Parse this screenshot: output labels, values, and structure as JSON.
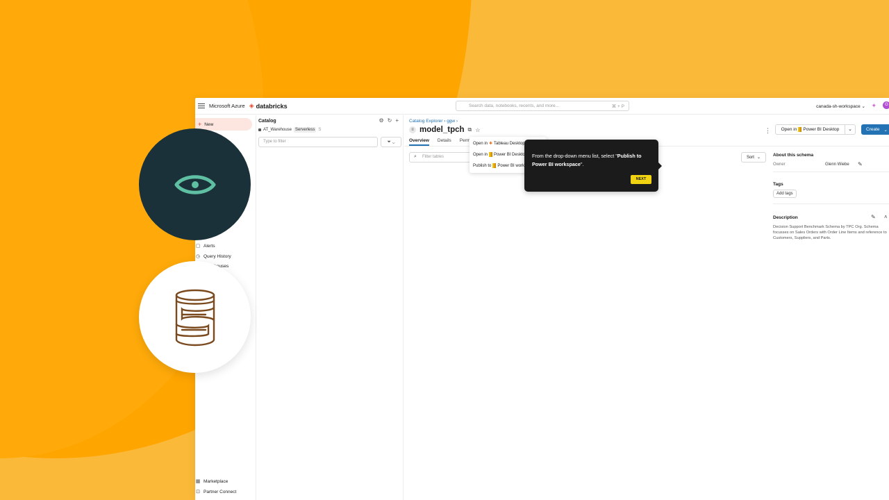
{
  "topbar": {
    "azure_label": "Microsoft Azure",
    "brand_label": "databricks",
    "search_placeholder": "Search data, notebooks, recents, and more...",
    "search_shortcut": "⌘ + P",
    "workspace": "canada-sh-workspace ⌄",
    "avatar_initial": "G"
  },
  "sidebar": {
    "new_label": "New",
    "items": [
      {
        "label": "Alerts",
        "icon": "bell-icon"
      },
      {
        "label": "Query History",
        "icon": "history-icon"
      },
      {
        "label": "Warehouses",
        "icon": "warehouse-icon"
      },
      {
        "label": "Marketplace",
        "icon": "store-icon"
      },
      {
        "label": "Partner Connect",
        "icon": "link-icon"
      }
    ]
  },
  "catalog": {
    "title": "Catalog",
    "warehouse_name": "AT_Warehouse",
    "warehouse_badge": "Serverless",
    "warehouse_size": "S",
    "filter_placeholder": "Type to filter"
  },
  "main": {
    "breadcrumb": "Catalog Explorer  ›  ggw  ›",
    "title": "model_tpch",
    "tabs": [
      "Overview",
      "Details",
      "Permissions"
    ],
    "filter_tables_placeholder": "Filter tables",
    "sort_label": "Sort",
    "open_in_label": "Open in",
    "open_in_target": "Power BI Desktop",
    "create_label": "Create"
  },
  "dropdown": {
    "items": [
      {
        "prefix": "Open in",
        "target": "Tableau Desktop",
        "icon": "tableau-icon"
      },
      {
        "prefix": "Open in",
        "target": "Power BI Desktop",
        "icon": "powerbi-icon"
      },
      {
        "prefix": "Publish to",
        "target": "Power BI workspace",
        "icon": "powerbi-icon"
      }
    ]
  },
  "tooltip": {
    "text_before": "From the drop-down menu list, select \"",
    "text_bold": "Publish to Power BI workspace",
    "text_after": "\".",
    "next_label": "NEXT"
  },
  "about": {
    "heading": "About this schema",
    "owner_label": "Owner",
    "owner_value": "Glenn Wiebe",
    "tags_heading": "Tags",
    "add_tags_label": "Add tags",
    "description_heading": "Description",
    "description_text": "Decision Support Benchmark Schema by TPC Org. Schema focusses on Sales Orders with Order Line Items and reference to Customers, Suppliers, and Parts."
  },
  "colors": {
    "background": "#FFA500",
    "dark_circle": "#1B3139",
    "eye_icon": "#5FBFA2",
    "database_icon": "#7A4A1E",
    "accent_blue": "#2272B4",
    "tooltip_bg": "#1B1B1B",
    "next_button": "#F2D312"
  }
}
